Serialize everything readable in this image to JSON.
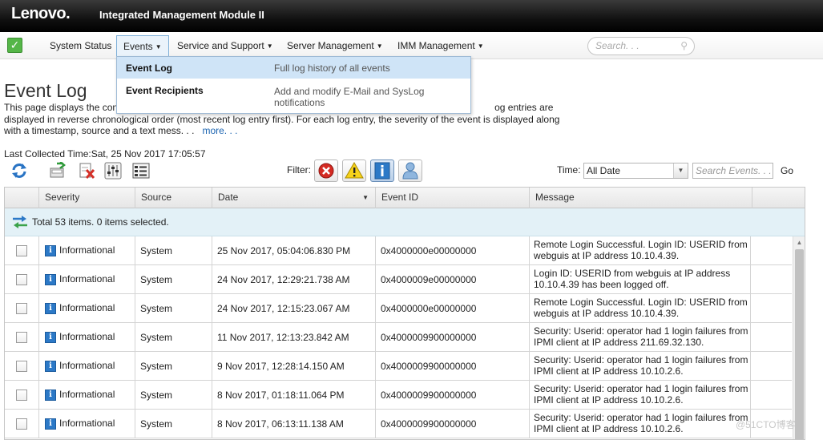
{
  "header": {
    "logo": "Lenovo.",
    "title": "Integrated Management Module II"
  },
  "nav": {
    "items": [
      {
        "label": "System Status"
      },
      {
        "label": "Events",
        "caret": "▼"
      },
      {
        "label": "Service and Support",
        "caret": "▼"
      },
      {
        "label": "Server Management",
        "caret": "▼"
      },
      {
        "label": "IMM Management",
        "caret": "▼"
      }
    ],
    "search_placeholder": "Search. . .",
    "status_icon": "check-icon"
  },
  "dropdown": {
    "items": [
      {
        "name": "Event Log",
        "desc": "Full log history of all events"
      },
      {
        "name": "Event Recipients",
        "desc": "Add and modify E-Mail and SysLog notifications"
      }
    ]
  },
  "page": {
    "title": "Event Log",
    "desc_line1": "This page displays the con",
    "desc_line1_tail": "og entries are",
    "desc_line2": "displayed in reverse chronological order (most recent log entry first). For each log entry, the severity of the event is displayed along",
    "desc_line3": "with a timestamp, source and a text mess. . .",
    "more": "more. . .",
    "last_collected": "Last Collected Time:Sat, 25 Nov 2017 17:05:57"
  },
  "toolbar": {
    "filter_label": "Filter:",
    "time_label": "Time:",
    "time_value": "All Date",
    "events_search_placeholder": "Search Events. . .",
    "go": "Go"
  },
  "grid": {
    "columns": [
      "Severity",
      "Source",
      "Date",
      "Event ID",
      "Message"
    ],
    "summary": "Total 53 items. 0 items selected.",
    "rows": [
      {
        "severity": "Informational",
        "source": "System",
        "date": "25 Nov 2017, 05:04:06.830 PM",
        "event_id": "0x4000000e00000000",
        "message": "Remote Login Successful. Login ID: USERID from webguis at IP address 10.10.4.39."
      },
      {
        "severity": "Informational",
        "source": "System",
        "date": "24 Nov 2017, 12:29:21.738 AM",
        "event_id": "0x4000009e00000000",
        "message": "Login ID: USERID from webguis at IP address 10.10.4.39 has been logged off."
      },
      {
        "severity": "Informational",
        "source": "System",
        "date": "24 Nov 2017, 12:15:23.067 AM",
        "event_id": "0x4000000e00000000",
        "message": "Remote Login Successful. Login ID: USERID from webguis at IP address 10.10.4.39."
      },
      {
        "severity": "Informational",
        "source": "System",
        "date": "11 Nov 2017, 12:13:23.842 AM",
        "event_id": "0x4000009900000000",
        "message": "Security: Userid: operator had 1 login failures from IPMI client at IP address 211.69.32.130."
      },
      {
        "severity": "Informational",
        "source": "System",
        "date": "9 Nov 2017, 12:28:14.150 AM",
        "event_id": "0x4000009900000000",
        "message": "Security: Userid: operator had 1 login failures from IPMI client at IP address 10.10.2.6."
      },
      {
        "severity": "Informational",
        "source": "System",
        "date": "8 Nov 2017, 01:18:11.064 PM",
        "event_id": "0x4000009900000000",
        "message": "Security: Userid: operator had 1 login failures from IPMI client at IP address 10.10.2.6."
      },
      {
        "severity": "Informational",
        "source": "System",
        "date": "8 Nov 2017, 06:13:11.138 AM",
        "event_id": "0x4000009900000000",
        "message": "Security: Userid: operator had 1 login failures from IPMI client at IP address 10.10.2.6."
      }
    ]
  },
  "watermark": "@51CTO博客",
  "colors": {
    "info_blue": "#2c79c7",
    "summary_bg": "#e3f1f7",
    "dropdown_active": "#cfe4f7"
  }
}
